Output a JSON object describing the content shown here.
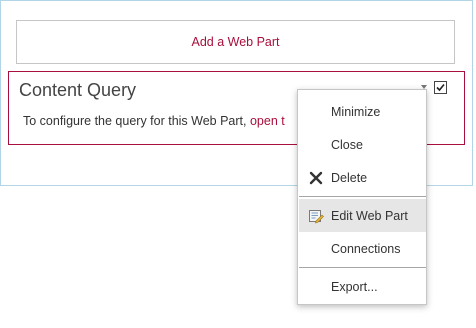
{
  "zone": {
    "add_web_part_label": "Add a Web Part"
  },
  "webpart": {
    "title": "Content Query",
    "description_prefix": "To configure the query for this Web Part, ",
    "description_link": "open t",
    "checkbox_checked": true,
    "menu_arrow_icon": "dropdown-arrow-icon"
  },
  "menu": {
    "items": [
      {
        "label": "Minimize",
        "icon": ""
      },
      {
        "label": "Close",
        "icon": ""
      },
      {
        "label": "Delete",
        "icon": "delete-x-icon"
      },
      {
        "label": "Edit Web Part",
        "icon": "edit-web-part-icon",
        "highlighted": true
      },
      {
        "label": "Connections",
        "icon": ""
      },
      {
        "label": "Export...",
        "icon": ""
      }
    ]
  },
  "colors": {
    "accent": "#a80f3c",
    "zone_border": "#b3d6e6",
    "menu_highlight": "#e6e6e6"
  }
}
